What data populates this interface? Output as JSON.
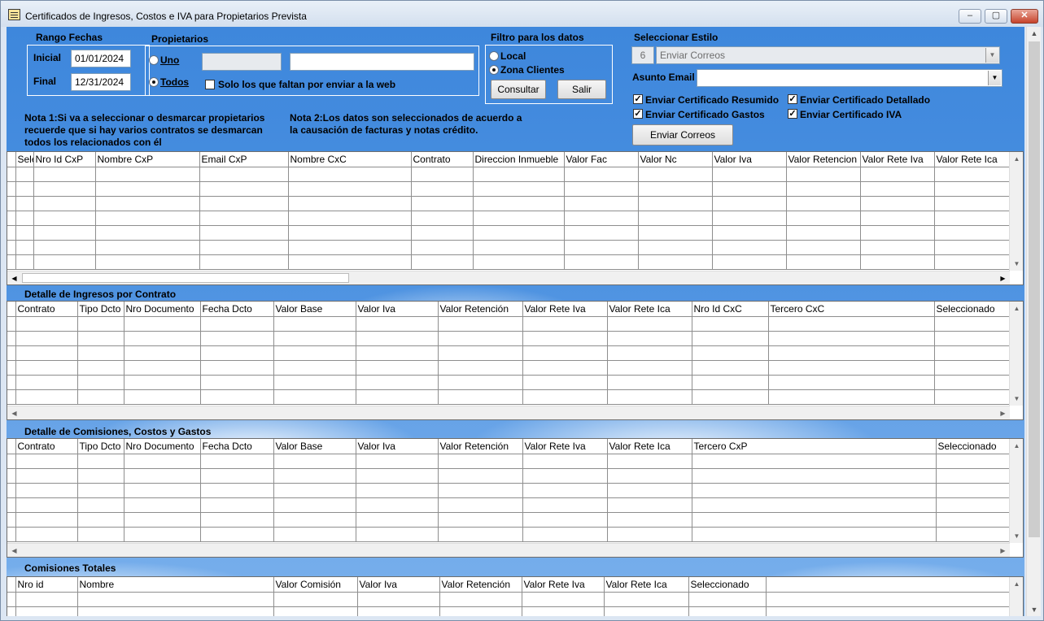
{
  "window": {
    "title": "Certificados de Ingresos, Costos e IVA para Propietarios Prevista",
    "controls": [
      "‒",
      "▢",
      "✕"
    ]
  },
  "rango": {
    "label": "Rango Fechas",
    "inicial_label": "Inicial",
    "inicial_value": "01/01/2024",
    "final_label": "Final",
    "final_value": "12/31/2024"
  },
  "propietarios": {
    "label": "Propietarios",
    "uno_label": "Uno",
    "todos_label": "Todos",
    "solo_label": "Solo los que faltan  por enviar a la web",
    "code_value": "",
    "name_value": ""
  },
  "filtro": {
    "label": "Filtro para los datos",
    "local_label": "Local",
    "zona_label": "Zona Clientes",
    "consultar_label": "Consultar",
    "salir_label": "Salir"
  },
  "estilo": {
    "label": "Seleccionar Estilo",
    "code": "6",
    "value": "Enviar Correos",
    "asunto_label": "Asunto Email",
    "asunto_value": "",
    "chk_resumido": "Enviar Certificado Resumido",
    "chk_detallado": "Enviar Certificado Detallado",
    "chk_gastos": "Enviar Certificado  Gastos",
    "chk_iva": "Enviar Certificado IVA",
    "enviar_label": "Enviar Correos"
  },
  "notes": {
    "note1": [
      "Nota 1:Si va a seleccionar o desmarcar propietarios",
      "recuerde que si hay varios contratos se desmarcan",
      "todos los relacionados con él"
    ],
    "note2": [
      "Nota 2:Los datos son seleccionados de acuerdo a",
      "la causación de facturas y notas crédito."
    ]
  },
  "grid1": {
    "columns": [
      "Sele",
      "Nro Id CxP",
      "Nombre CxP",
      "Email CxP",
      "Nombre CxC",
      "Contrato",
      "Direccion Inmueble",
      "Valor Fac",
      "Valor Nc",
      "Valor Iva",
      "Valor Retencion",
      "Valor Rete Iva",
      "Valor Rete Ica"
    ]
  },
  "grid2": {
    "title": "Detalle de Ingresos por Contrato",
    "columns": [
      "Contrato",
      "Tipo Dcto",
      "Nro Documento",
      "Fecha Dcto",
      "Valor Base",
      "Valor Iva",
      "Valor Retención",
      "Valor Rete Iva",
      "Valor Rete Ica",
      "Nro Id CxC",
      "Tercero CxC",
      "Seleccionado"
    ]
  },
  "grid3": {
    "title": "Detalle de Comisiones, Costos y Gastos",
    "columns": [
      "Contrato",
      "Tipo Dcto",
      "Nro Documento",
      "Fecha Dcto",
      "Valor Base",
      "Valor Iva",
      "Valor Retención",
      "Valor Rete Iva",
      "Valor Rete Ica",
      "Tercero CxP",
      "Seleccionado"
    ]
  },
  "grid4": {
    "title": "Comisiones Totales",
    "columns": [
      "Nro id",
      "Nombre",
      "Valor Comisión",
      "Valor Iva",
      "Valor Retención",
      "Valor Rete Iva",
      "Valor Rete Ica",
      "Seleccionado"
    ]
  }
}
